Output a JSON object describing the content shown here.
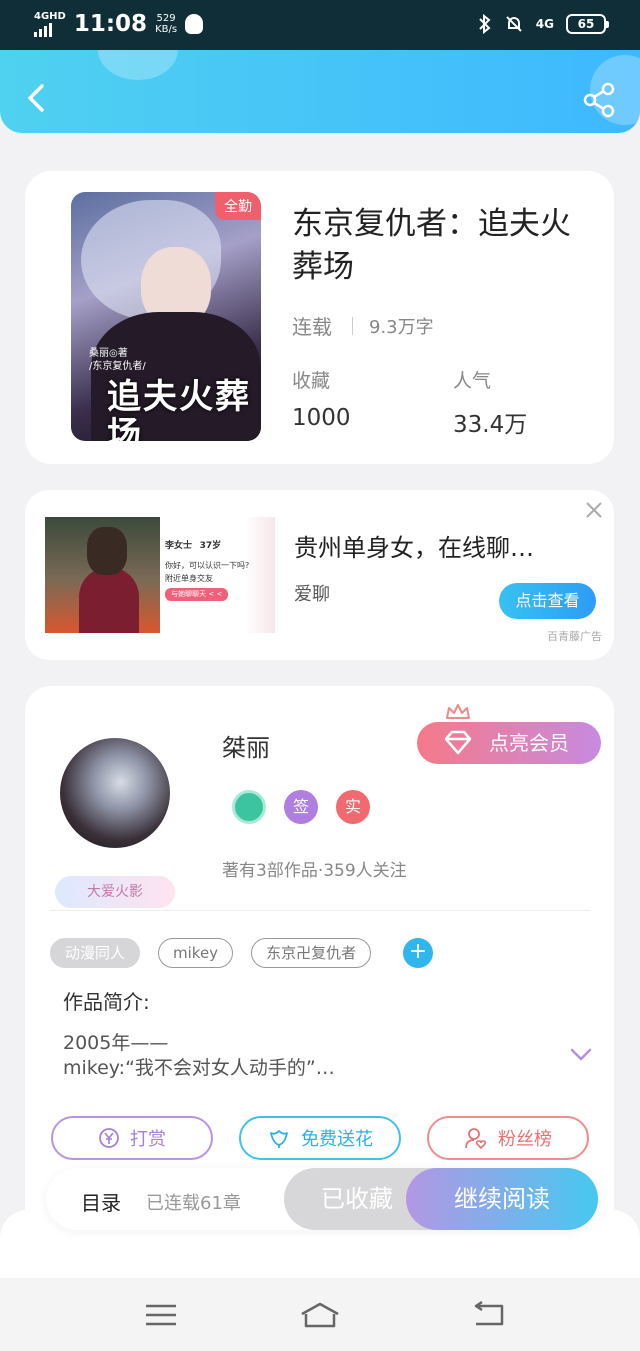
{
  "status_bar": {
    "network": "4GHD",
    "time": "11:08",
    "speed_value": "529",
    "speed_unit": "KB/s",
    "net_right": "4G",
    "battery": "65"
  },
  "book": {
    "badge": "全勤",
    "title": "东京复仇者：追夫火葬场",
    "status": "连载",
    "words": "9.3万字",
    "favorites_label": "收藏",
    "favorites_value": "1000",
    "popularity_label": "人气",
    "popularity_value": "33.4万",
    "cover_title": "追夫火葬场",
    "cover_author_line": "桑丽◎著",
    "cover_series_line": "/东京复仇者/"
  },
  "ad": {
    "title": "贵州单身女，在线聊…",
    "subtitle": "爱聊",
    "button": "点击查看",
    "mark": "百青藤广告",
    "chat_name": "李女士",
    "chat_age": "37岁",
    "chat_line1": "你好，可以认识一下吗?",
    "chat_line2": "附近单身交友",
    "chat_button": "与她聊聊天 < <"
  },
  "author": {
    "name": "桀丽",
    "vip_button": "点亮会员",
    "fan_tag": "大爱火影",
    "badge_sign": "签",
    "badge_real": "实",
    "stats": "著有3部作品·359人关注",
    "tags": [
      "动漫同人",
      "mikey",
      "东京卍复仇者"
    ],
    "intro_heading": "作品简介:",
    "intro_line1": "2005年——",
    "intro_line2": "mikey:“我不会对女人动手的”…",
    "action_reward": "打赏",
    "action_flower": "免费送花",
    "action_fans": "粉丝榜"
  },
  "read_bar": {
    "toc": "目录",
    "chapters": "已连载61章",
    "favorited": "已收藏",
    "continue": "继续阅读"
  },
  "colors": {
    "header_start": "#4fd1f0",
    "header_end": "#3eb8ff",
    "accent_blue": "#2fb6ee",
    "vip_pink": "#f57a88"
  }
}
